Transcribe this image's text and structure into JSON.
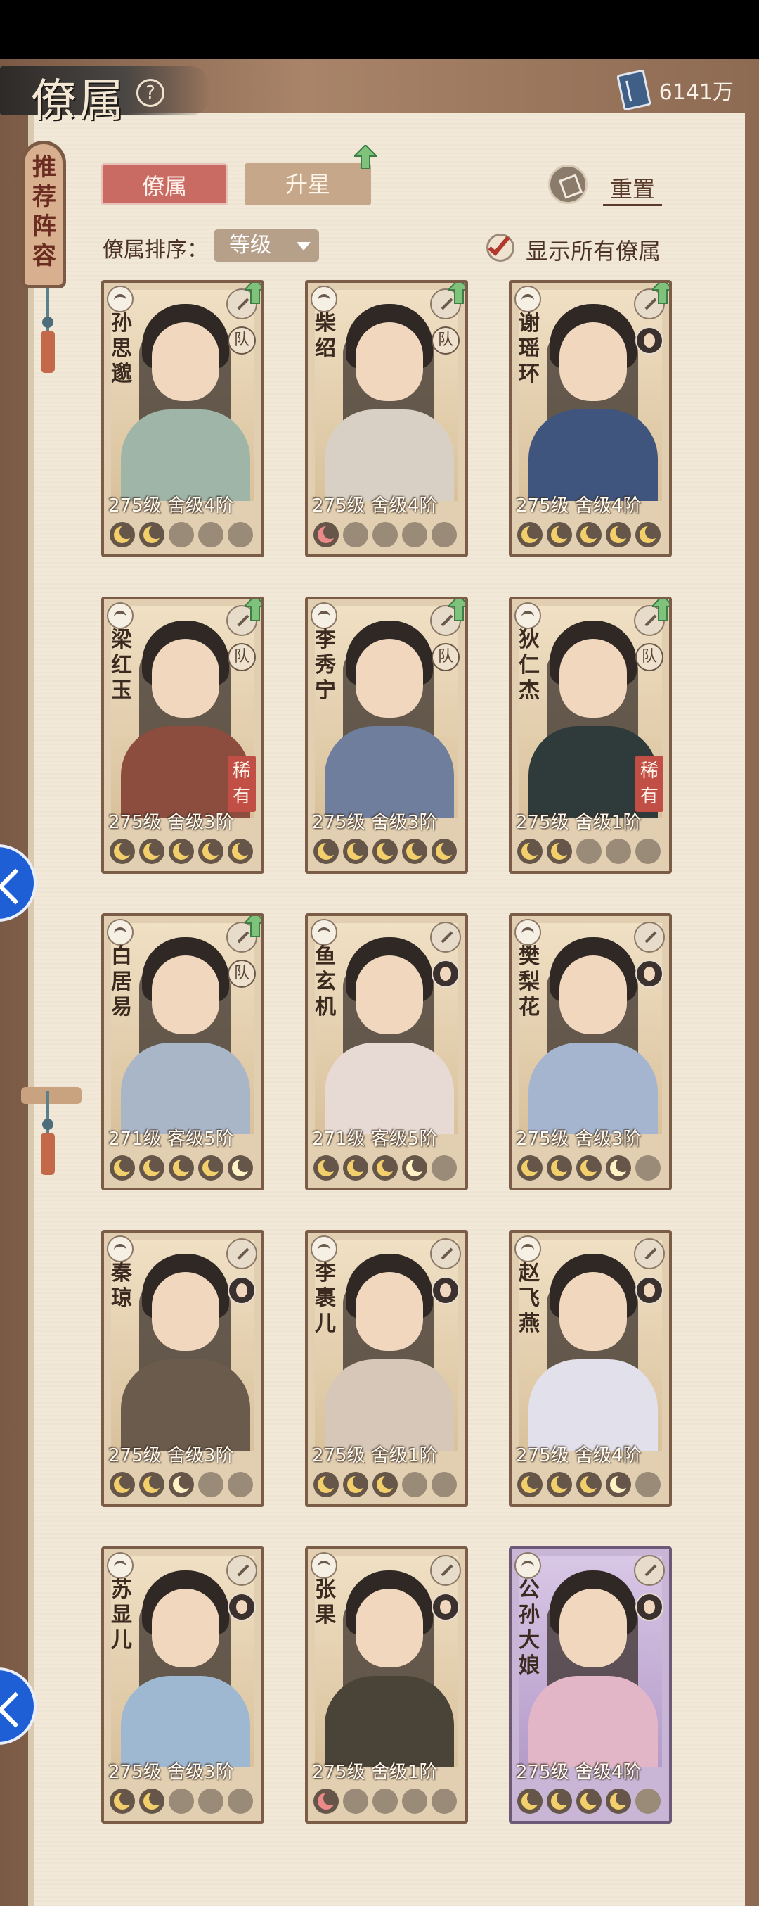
{
  "header": {
    "title": "僚属",
    "help_icon": "help-circle-icon",
    "currency": {
      "icon": "book-icon",
      "value": "6141万"
    }
  },
  "side_tab": {
    "label": "推荐阵容"
  },
  "tabs": [
    {
      "label": "僚属",
      "active": true
    },
    {
      "label": "升星",
      "active": false
    }
  ],
  "reset": {
    "label": "重置"
  },
  "sort": {
    "label": "僚属排序：",
    "selected": "等级"
  },
  "show_all": {
    "label": "显示所有僚属",
    "checked": true
  },
  "cards": [
    {
      "name": "孙思邈",
      "level": "275级",
      "rank": "舍级4阶",
      "team": "队",
      "up": true,
      "rare": "",
      "moons": [
        "lit",
        "lit",
        "off",
        "off",
        "off"
      ]
    },
    {
      "name": "柴绍",
      "level": "275级",
      "rank": "舍级4阶",
      "team": "队",
      "up": true,
      "rare": "",
      "moons": [
        "pink",
        "off",
        "off",
        "off",
        "off"
      ]
    },
    {
      "name": "谢瑶环",
      "level": "275级",
      "rank": "舍级4阶",
      "team": "",
      "up": true,
      "rare": "",
      "moons": [
        "lit",
        "lit",
        "lit",
        "lit",
        "lit"
      ]
    },
    {
      "name": "梁红玉",
      "level": "275级",
      "rank": "舍级3阶",
      "team": "队",
      "up": true,
      "rare": "稀有",
      "moons": [
        "lit",
        "lit",
        "lit",
        "lit",
        "lit"
      ]
    },
    {
      "name": "李秀宁",
      "level": "275级",
      "rank": "舍级3阶",
      "team": "队",
      "up": true,
      "rare": "",
      "moons": [
        "lit",
        "lit",
        "lit",
        "lit",
        "lit"
      ]
    },
    {
      "name": "狄仁杰",
      "level": "275级",
      "rank": "舍级1阶",
      "team": "队",
      "up": true,
      "rare": "稀有",
      "moons": [
        "lit",
        "lit",
        "off",
        "off",
        "off"
      ]
    },
    {
      "name": "白居易",
      "level": "271级",
      "rank": "客级5阶",
      "team": "队",
      "up": true,
      "rare": "",
      "moons": [
        "lit",
        "lit",
        "lit",
        "lit",
        "half"
      ]
    },
    {
      "name": "鱼玄机",
      "level": "271级",
      "rank": "客级5阶",
      "team": "",
      "up": false,
      "rare": "",
      "moons": [
        "lit",
        "lit",
        "lit",
        "half",
        "off"
      ]
    },
    {
      "name": "樊梨花",
      "level": "275级",
      "rank": "舍级3阶",
      "team": "",
      "up": false,
      "rare": "",
      "moons": [
        "lit",
        "lit",
        "lit",
        "half",
        "off"
      ]
    },
    {
      "name": "秦琼",
      "level": "275级",
      "rank": "舍级3阶",
      "team": "",
      "up": false,
      "rare": "",
      "moons": [
        "lit",
        "lit",
        "half",
        "off",
        "off"
      ]
    },
    {
      "name": "李裹儿",
      "level": "275级",
      "rank": "舍级1阶",
      "team": "",
      "up": false,
      "rare": "",
      "moons": [
        "lit",
        "lit",
        "lit",
        "off",
        "off"
      ]
    },
    {
      "name": "赵飞燕",
      "level": "275级",
      "rank": "舍级4阶",
      "team": "",
      "up": false,
      "rare": "",
      "moons": [
        "lit",
        "lit",
        "lit",
        "half",
        "off"
      ]
    },
    {
      "name": "苏显儿",
      "level": "275级",
      "rank": "舍级3阶",
      "team": "",
      "up": false,
      "rare": "",
      "moons": [
        "lit",
        "lit",
        "off",
        "off",
        "off"
      ]
    },
    {
      "name": "张果",
      "level": "275级",
      "rank": "舍级1阶",
      "team": "",
      "up": false,
      "rare": "",
      "moons": [
        "pink",
        "off",
        "off",
        "off",
        "off"
      ]
    },
    {
      "name": "公孙大娘",
      "level": "275级",
      "rank": "舍级4阶",
      "team": "",
      "up": false,
      "rare": "",
      "moons": [
        "lit",
        "lit",
        "lit",
        "lit",
        "off"
      ],
      "epic": true
    }
  ]
}
